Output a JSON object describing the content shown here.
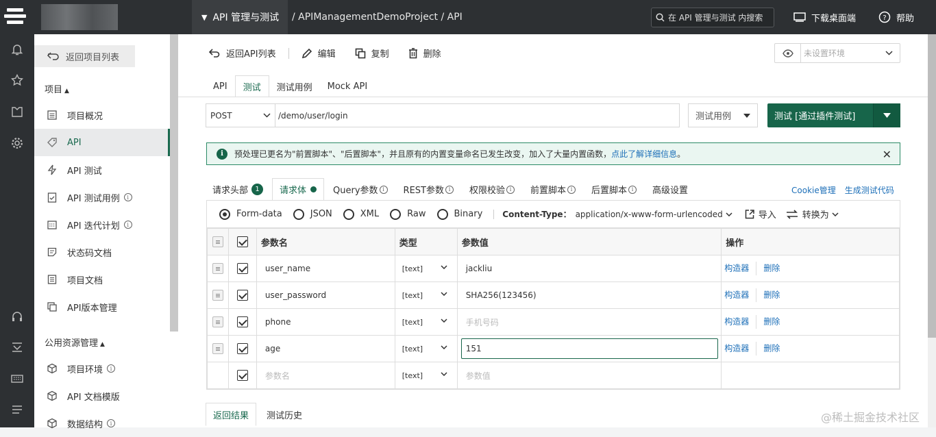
{
  "topbar": {
    "module": "API 管理与测试",
    "path": "/ APIManagementDemoProject / API",
    "search_placeholder": "在 API 管理与测试 内搜索",
    "download": "下载桌面端",
    "help": "帮助"
  },
  "sidebar": {
    "back": "返回项目列表",
    "section_project": "项目",
    "project_items": [
      {
        "label": "项目概况"
      },
      {
        "label": "API"
      },
      {
        "label": "API 测试"
      },
      {
        "label": "API 测试用例"
      },
      {
        "label": "API 迭代计划"
      },
      {
        "label": "状态码文档"
      },
      {
        "label": "项目文档"
      },
      {
        "label": "API版本管理"
      }
    ],
    "section_shared": "公用资源管理",
    "shared_items": [
      {
        "label": "项目环境"
      },
      {
        "label": "API 文档模版"
      },
      {
        "label": "数据结构"
      }
    ]
  },
  "toolbar": {
    "back": "返回API列表",
    "edit": "编辑",
    "copy": "复制",
    "delete": "删除",
    "env_placeholder": "未设置环境"
  },
  "tabs": [
    "API",
    "测试",
    "测试用例",
    "Mock API"
  ],
  "request": {
    "method": "POST",
    "url": "/demo/user/login",
    "case_select": "测试用例",
    "test_button": "测试 [通过插件测试]"
  },
  "notice": {
    "text": "预处理已更名为\"前置脚本\"、\"后置脚本\"，并且原有的内置变量命名已发生改变，加入了大量内置函数，",
    "link": "点此了解详细信息",
    "end": "。"
  },
  "subtabs": {
    "headers": "请求头部",
    "headers_count": "1",
    "body": "请求体",
    "query": "Query参数",
    "rest": "REST参数",
    "auth": "权限校验",
    "pre": "前置脚本",
    "post": "后置脚本",
    "advanced": "高级设置",
    "cookie": "Cookie管理",
    "gen_code": "生成测试代码"
  },
  "body": {
    "formats": [
      "Form-data",
      "JSON",
      "XML",
      "Raw",
      "Binary"
    ],
    "content_type_label": "Content-Type：",
    "content_type": "application/x-www-form-urlencoded",
    "import": "导入",
    "convert": "转换为",
    "columns": {
      "name": "参数名",
      "type": "类型",
      "value": "参数值",
      "op": "操作"
    },
    "rows": [
      {
        "name": "user_name",
        "type": "[text]",
        "value": "jackliu",
        "builder": "构造器",
        "del": "删除"
      },
      {
        "name": "user_password",
        "type": "[text]",
        "value": "SHA256(123456)",
        "builder": "构造器",
        "del": "删除"
      },
      {
        "name": "phone",
        "type": "[text]",
        "value": "手机号码",
        "builder": "构造器",
        "del": "删除"
      },
      {
        "name": "age",
        "type": "[text]",
        "value": "151",
        "builder": "构造器",
        "del": "删除"
      }
    ],
    "new_row": {
      "name": "参数名",
      "type": "[text]",
      "value": "参数值"
    }
  },
  "result_tabs": [
    "返回结果",
    "测试历史"
  ],
  "watermark": "@稀土掘金技术社区",
  "colors": {
    "brand": "#17654a",
    "link": "#1d6fb8",
    "topbar": "#2d3033"
  }
}
